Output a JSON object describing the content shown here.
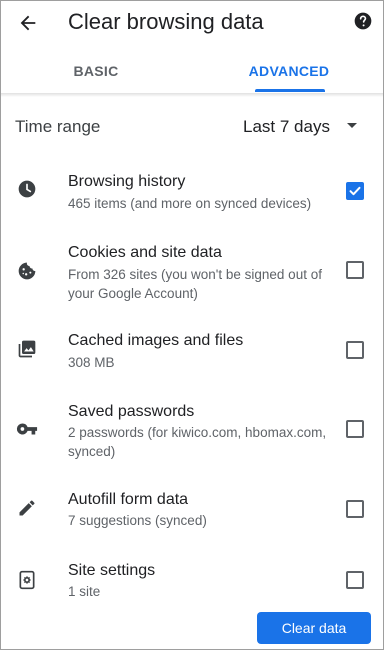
{
  "header": {
    "title": "Clear browsing data",
    "back_icon": "arrow-back-icon",
    "help_icon": "help-icon"
  },
  "tabs": [
    {
      "label": "BASIC",
      "selected": false
    },
    {
      "label": "ADVANCED",
      "selected": true
    }
  ],
  "time_range": {
    "label": "Time range",
    "value": "Last 7 days"
  },
  "items": [
    {
      "title": "Browsing history",
      "desc": "465 items (and more on synced devices)",
      "icon": "clock-icon",
      "checked": true
    },
    {
      "title": "Cookies and site data",
      "desc": "From 326 sites (you won't be signed out of your Google Account)",
      "icon": "cookie-icon",
      "checked": false
    },
    {
      "title": "Cached images and files",
      "desc": "308 MB",
      "icon": "image-icon",
      "checked": false
    },
    {
      "title": "Saved passwords",
      "desc": "2 passwords (for kiwico.com, hbomax.com, synced)",
      "icon": "key-icon",
      "checked": false
    },
    {
      "title": "Autofill form data",
      "desc": "7 suggestions (synced)",
      "icon": "pencil-icon",
      "checked": false
    },
    {
      "title": "Site settings",
      "desc": "1 site",
      "icon": "settings-page-icon",
      "checked": false
    }
  ],
  "actions": {
    "clear_label": "Clear data"
  },
  "colors": {
    "accent": "#1a73e8",
    "text_primary": "#202124",
    "text_secondary": "#5f6368"
  }
}
